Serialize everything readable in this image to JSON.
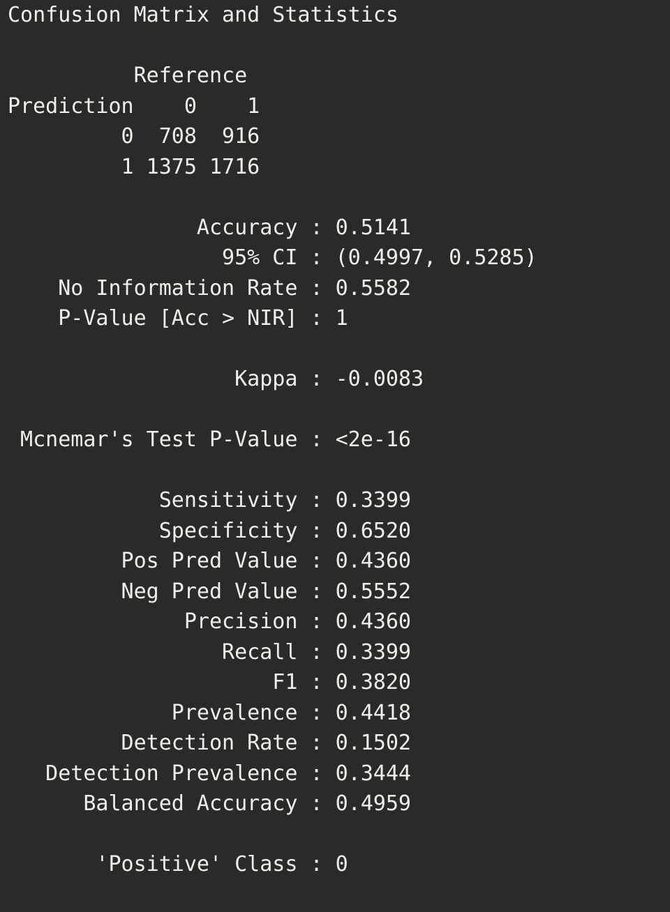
{
  "terminal": {
    "lines": [
      "Confusion Matrix and Statistics",
      "          Reference",
      "Prediction    0    1",
      "         0  708  916",
      "         1 1375 1716",
      "               Accuracy : 0.5141",
      "                 95% CI : (0.4997, 0.5285)",
      "    No Information Rate : 0.5582",
      "    P-Value [Acc > NIR] : 1",
      "                  Kappa : -0.0083",
      " Mcnemar's Test P-Value : <2e-16",
      "            Sensitivity : 0.3399",
      "            Specificity : 0.6520",
      "         Pos Pred Value : 0.4360",
      "         Neg Pred Value : 0.5552",
      "              Precision : 0.4360",
      "                 Recall : 0.3399",
      "                     F1 : 0.3820",
      "             Prevalence : 0.4418",
      "         Detection Rate : 0.1502",
      "   Detection Prevalence : 0.3444",
      "      Balanced Accuracy : 0.4959",
      "       'Positive' Class : 0"
    ]
  }
}
